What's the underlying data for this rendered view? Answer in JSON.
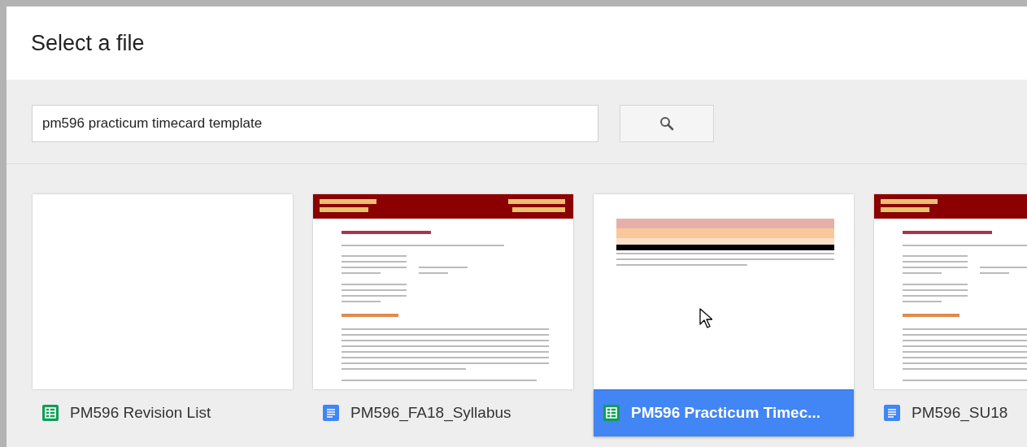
{
  "dialog": {
    "title": "Select a file"
  },
  "search": {
    "value": "pm596 practicum timecard template"
  },
  "files": [
    {
      "name": "PM596 Revision List",
      "kind": "sheet",
      "thumbnail": {
        "kind": "blank"
      },
      "selected": false,
      "cursor": false
    },
    {
      "name": "PM596_FA18_Syllabus",
      "kind": "doc",
      "thumbnail": {
        "kind": "syllabus"
      },
      "selected": false,
      "cursor": false
    },
    {
      "name": "PM596 Practicum Timec...",
      "kind": "sheet",
      "thumbnail": {
        "kind": "timecard"
      },
      "selected": true,
      "cursor": true
    },
    {
      "name": "PM596_SU18",
      "kind": "doc",
      "thumbnail": {
        "kind": "syllabus"
      },
      "selected": false,
      "cursor": false
    }
  ]
}
